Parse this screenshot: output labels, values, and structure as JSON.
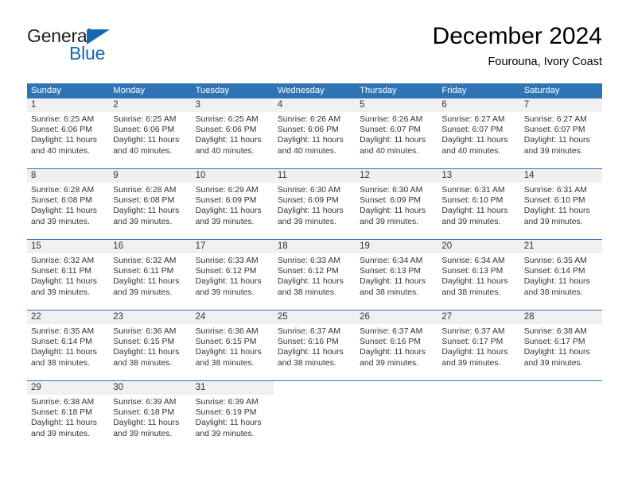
{
  "brand": {
    "name_top": "General",
    "name_bottom": "Blue",
    "triangle_color": "#1268b3"
  },
  "header": {
    "title": "December 2024",
    "location": "Fourouna, Ivory Coast"
  },
  "theme": {
    "header_blue": "#2e74b5",
    "daynum_bg": "#f0f0f0",
    "text": "#333333"
  },
  "calendar": {
    "weekdays": [
      "Sunday",
      "Monday",
      "Tuesday",
      "Wednesday",
      "Thursday",
      "Friday",
      "Saturday"
    ],
    "weeks": [
      [
        {
          "day": "1",
          "sunrise": "Sunrise: 6:25 AM",
          "sunset": "Sunset: 6:06 PM",
          "daylight_l1": "Daylight: 11 hours",
          "daylight_l2": "and 40 minutes."
        },
        {
          "day": "2",
          "sunrise": "Sunrise: 6:25 AM",
          "sunset": "Sunset: 6:06 PM",
          "daylight_l1": "Daylight: 11 hours",
          "daylight_l2": "and 40 minutes."
        },
        {
          "day": "3",
          "sunrise": "Sunrise: 6:25 AM",
          "sunset": "Sunset: 6:06 PM",
          "daylight_l1": "Daylight: 11 hours",
          "daylight_l2": "and 40 minutes."
        },
        {
          "day": "4",
          "sunrise": "Sunrise: 6:26 AM",
          "sunset": "Sunset: 6:06 PM",
          "daylight_l1": "Daylight: 11 hours",
          "daylight_l2": "and 40 minutes."
        },
        {
          "day": "5",
          "sunrise": "Sunrise: 6:26 AM",
          "sunset": "Sunset: 6:07 PM",
          "daylight_l1": "Daylight: 11 hours",
          "daylight_l2": "and 40 minutes."
        },
        {
          "day": "6",
          "sunrise": "Sunrise: 6:27 AM",
          "sunset": "Sunset: 6:07 PM",
          "daylight_l1": "Daylight: 11 hours",
          "daylight_l2": "and 40 minutes."
        },
        {
          "day": "7",
          "sunrise": "Sunrise: 6:27 AM",
          "sunset": "Sunset: 6:07 PM",
          "daylight_l1": "Daylight: 11 hours",
          "daylight_l2": "and 39 minutes."
        }
      ],
      [
        {
          "day": "8",
          "sunrise": "Sunrise: 6:28 AM",
          "sunset": "Sunset: 6:08 PM",
          "daylight_l1": "Daylight: 11 hours",
          "daylight_l2": "and 39 minutes."
        },
        {
          "day": "9",
          "sunrise": "Sunrise: 6:28 AM",
          "sunset": "Sunset: 6:08 PM",
          "daylight_l1": "Daylight: 11 hours",
          "daylight_l2": "and 39 minutes."
        },
        {
          "day": "10",
          "sunrise": "Sunrise: 6:29 AM",
          "sunset": "Sunset: 6:09 PM",
          "daylight_l1": "Daylight: 11 hours",
          "daylight_l2": "and 39 minutes."
        },
        {
          "day": "11",
          "sunrise": "Sunrise: 6:30 AM",
          "sunset": "Sunset: 6:09 PM",
          "daylight_l1": "Daylight: 11 hours",
          "daylight_l2": "and 39 minutes."
        },
        {
          "day": "12",
          "sunrise": "Sunrise: 6:30 AM",
          "sunset": "Sunset: 6:09 PM",
          "daylight_l1": "Daylight: 11 hours",
          "daylight_l2": "and 39 minutes."
        },
        {
          "day": "13",
          "sunrise": "Sunrise: 6:31 AM",
          "sunset": "Sunset: 6:10 PM",
          "daylight_l1": "Daylight: 11 hours",
          "daylight_l2": "and 39 minutes."
        },
        {
          "day": "14",
          "sunrise": "Sunrise: 6:31 AM",
          "sunset": "Sunset: 6:10 PM",
          "daylight_l1": "Daylight: 11 hours",
          "daylight_l2": "and 39 minutes."
        }
      ],
      [
        {
          "day": "15",
          "sunrise": "Sunrise: 6:32 AM",
          "sunset": "Sunset: 6:11 PM",
          "daylight_l1": "Daylight: 11 hours",
          "daylight_l2": "and 39 minutes."
        },
        {
          "day": "16",
          "sunrise": "Sunrise: 6:32 AM",
          "sunset": "Sunset: 6:11 PM",
          "daylight_l1": "Daylight: 11 hours",
          "daylight_l2": "and 39 minutes."
        },
        {
          "day": "17",
          "sunrise": "Sunrise: 6:33 AM",
          "sunset": "Sunset: 6:12 PM",
          "daylight_l1": "Daylight: 11 hours",
          "daylight_l2": "and 39 minutes."
        },
        {
          "day": "18",
          "sunrise": "Sunrise: 6:33 AM",
          "sunset": "Sunset: 6:12 PM",
          "daylight_l1": "Daylight: 11 hours",
          "daylight_l2": "and 38 minutes."
        },
        {
          "day": "19",
          "sunrise": "Sunrise: 6:34 AM",
          "sunset": "Sunset: 6:13 PM",
          "daylight_l1": "Daylight: 11 hours",
          "daylight_l2": "and 38 minutes."
        },
        {
          "day": "20",
          "sunrise": "Sunrise: 6:34 AM",
          "sunset": "Sunset: 6:13 PM",
          "daylight_l1": "Daylight: 11 hours",
          "daylight_l2": "and 38 minutes."
        },
        {
          "day": "21",
          "sunrise": "Sunrise: 6:35 AM",
          "sunset": "Sunset: 6:14 PM",
          "daylight_l1": "Daylight: 11 hours",
          "daylight_l2": "and 38 minutes."
        }
      ],
      [
        {
          "day": "22",
          "sunrise": "Sunrise: 6:35 AM",
          "sunset": "Sunset: 6:14 PM",
          "daylight_l1": "Daylight: 11 hours",
          "daylight_l2": "and 38 minutes."
        },
        {
          "day": "23",
          "sunrise": "Sunrise: 6:36 AM",
          "sunset": "Sunset: 6:15 PM",
          "daylight_l1": "Daylight: 11 hours",
          "daylight_l2": "and 38 minutes."
        },
        {
          "day": "24",
          "sunrise": "Sunrise: 6:36 AM",
          "sunset": "Sunset: 6:15 PM",
          "daylight_l1": "Daylight: 11 hours",
          "daylight_l2": "and 38 minutes."
        },
        {
          "day": "25",
          "sunrise": "Sunrise: 6:37 AM",
          "sunset": "Sunset: 6:16 PM",
          "daylight_l1": "Daylight: 11 hours",
          "daylight_l2": "and 38 minutes."
        },
        {
          "day": "26",
          "sunrise": "Sunrise: 6:37 AM",
          "sunset": "Sunset: 6:16 PM",
          "daylight_l1": "Daylight: 11 hours",
          "daylight_l2": "and 39 minutes."
        },
        {
          "day": "27",
          "sunrise": "Sunrise: 6:37 AM",
          "sunset": "Sunset: 6:17 PM",
          "daylight_l1": "Daylight: 11 hours",
          "daylight_l2": "and 39 minutes."
        },
        {
          "day": "28",
          "sunrise": "Sunrise: 6:38 AM",
          "sunset": "Sunset: 6:17 PM",
          "daylight_l1": "Daylight: 11 hours",
          "daylight_l2": "and 39 minutes."
        }
      ],
      [
        {
          "day": "29",
          "sunrise": "Sunrise: 6:38 AM",
          "sunset": "Sunset: 6:18 PM",
          "daylight_l1": "Daylight: 11 hours",
          "daylight_l2": "and 39 minutes."
        },
        {
          "day": "30",
          "sunrise": "Sunrise: 6:39 AM",
          "sunset": "Sunset: 6:18 PM",
          "daylight_l1": "Daylight: 11 hours",
          "daylight_l2": "and 39 minutes."
        },
        {
          "day": "31",
          "sunrise": "Sunrise: 6:39 AM",
          "sunset": "Sunset: 6:19 PM",
          "daylight_l1": "Daylight: 11 hours",
          "daylight_l2": "and 39 minutes."
        },
        {
          "day": "",
          "sunrise": "",
          "sunset": "",
          "daylight_l1": "",
          "daylight_l2": ""
        },
        {
          "day": "",
          "sunrise": "",
          "sunset": "",
          "daylight_l1": "",
          "daylight_l2": ""
        },
        {
          "day": "",
          "sunrise": "",
          "sunset": "",
          "daylight_l1": "",
          "daylight_l2": ""
        },
        {
          "day": "",
          "sunrise": "",
          "sunset": "",
          "daylight_l1": "",
          "daylight_l2": ""
        }
      ]
    ]
  }
}
